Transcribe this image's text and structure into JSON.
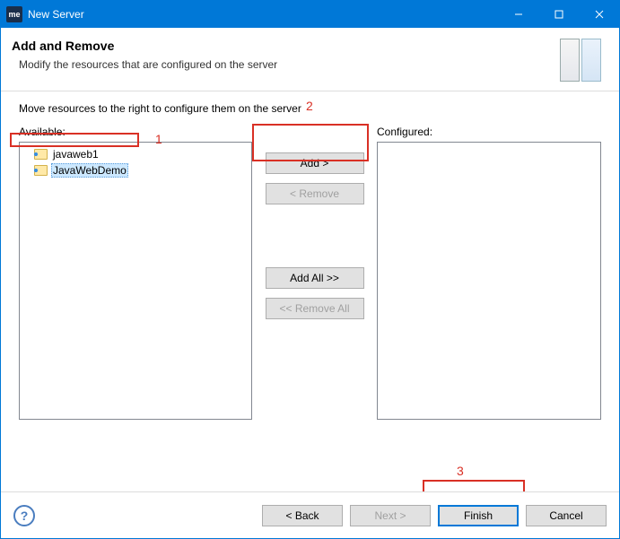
{
  "window": {
    "app_badge": "me",
    "title": "New Server"
  },
  "header": {
    "title": "Add and Remove",
    "subtitle": "Modify the resources that are configured on the server"
  },
  "instruction": "Move resources to the right to configure them on the server",
  "labels": {
    "available": "Available:",
    "configured": "Configured:"
  },
  "available_items": [
    {
      "name": "javaweb1",
      "selected": false
    },
    {
      "name": "JavaWebDemo",
      "selected": true
    }
  ],
  "configured_items": [],
  "buttons": {
    "add": "Add >",
    "remove": "< Remove",
    "add_all": "Add All >>",
    "remove_all": "<< Remove All",
    "back": "< Back",
    "next": "Next >",
    "finish": "Finish",
    "cancel": "Cancel"
  },
  "annotations": {
    "n1": "1",
    "n2": "2",
    "n3": "3"
  }
}
